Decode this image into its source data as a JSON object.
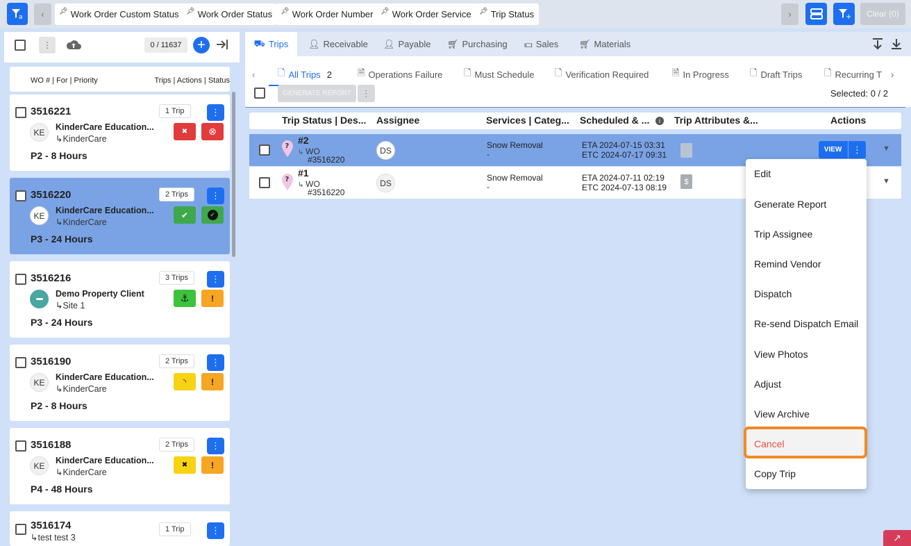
{
  "filters": {
    "chips": [
      "Work Order Custom Status",
      "Work Order Status",
      "Work Order Number",
      "Work Order Service",
      "Trip Status"
    ],
    "clear_label": "Clear (0)"
  },
  "sidebar": {
    "counter": "0 / 11637",
    "header_left": "WO # | For | Priority",
    "header_right": "Trips | Actions | Status",
    "cards": [
      {
        "wo": "3516221",
        "trips": "1 Trip",
        "avatar": "KE",
        "client": "KinderCare Education...",
        "site": "↳KinderCare",
        "priority": "P2 - 8 Hours",
        "status_a": "✖",
        "status_b": "⊗"
      },
      {
        "wo": "3516220",
        "trips": "2 Trips",
        "avatar": "KE",
        "client": "KinderCare Education...",
        "site": "↳KinderCare",
        "priority": "P3 - 24 Hours",
        "status_a": "✔",
        "status_b": "✔"
      },
      {
        "wo": "3516216",
        "trips": "3 Trips",
        "avatar": "",
        "client": "Demo Property Client",
        "site": "↳Site 1",
        "priority": "P3 - 24 Hours",
        "status_a": "⚓",
        "status_b": "!"
      },
      {
        "wo": "3516190",
        "trips": "2 Trips",
        "avatar": "KE",
        "client": "KinderCare Education...",
        "site": "↳KinderCare",
        "priority": "P2 - 8 Hours",
        "status_a": "◝",
        "status_b": "!"
      },
      {
        "wo": "3516188",
        "trips": "2 Trips",
        "avatar": "KE",
        "client": "KinderCare Education...",
        "site": "↳KinderCare",
        "priority": "P4 - 48 Hours",
        "status_a": "✖",
        "status_b": "!"
      },
      {
        "wo": "3516174",
        "trips": "1 Trip",
        "site": "↳test test 3"
      }
    ]
  },
  "tabs": [
    "Trips",
    "Receivable",
    "Payable",
    "Purchasing",
    "Sales",
    "Materials"
  ],
  "subtabs": {
    "all_trips": "All Trips",
    "all_trips_count": "2",
    "others": [
      "Operations Failure",
      "Must Schedule",
      "Verification Required",
      "In Progress",
      "Draft Trips",
      "Recurring T"
    ]
  },
  "toolbar": {
    "generate_report": "GENERATE REPORT",
    "selected": "Selected: 0 / 2"
  },
  "columns": [
    "Trip Status | Des...",
    "Assignee",
    "Services | Categ...",
    "Scheduled & ...",
    "Trip Attributes &...",
    "Actions"
  ],
  "rows": [
    {
      "num": "#2",
      "wo": "WO",
      "wo_num": "#3516220",
      "assignee": "DS",
      "service": "Snow Removal",
      "cat": "-",
      "eta": "ETA 2024-07-15 03:31",
      "etc": "ETC 2024-07-17 09:31",
      "view": "VIEW"
    },
    {
      "num": "#1",
      "wo": "WO",
      "wo_num": "#3516220",
      "assignee": "DS",
      "service": "Snow Removal",
      "cat": "-",
      "eta": "ETA 2024-07-11 02:19",
      "etc": "ETC 2024-07-13 08:19"
    }
  ],
  "menu": [
    "Edit",
    "Generate Report",
    "Trip Assignee",
    "Remind Vendor",
    "Dispatch",
    "Re-send Dispatch Email",
    "View Photos",
    "Adjust",
    "View Archive",
    "Cancel",
    "Copy Trip"
  ],
  "colors": {
    "accent": "#1e6ff0",
    "selected_card": "#7aa3e6",
    "selected_row": "#7aa3e6",
    "cancel": "#e5533d",
    "highlight": "#f08a24"
  }
}
